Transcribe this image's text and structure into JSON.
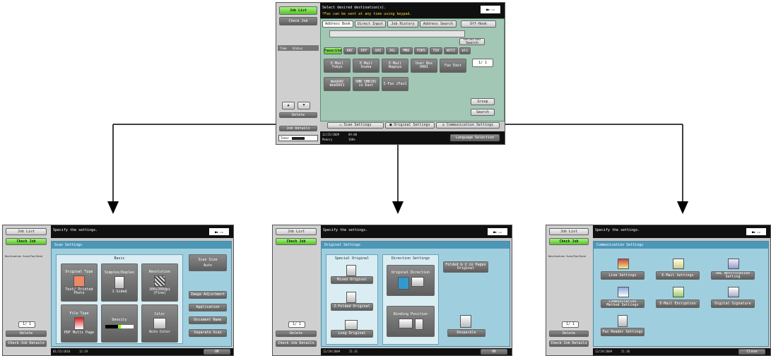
{
  "top_screen": {
    "job_list": "Job List",
    "check_job": "Check Job",
    "status_cols": [
      "Time",
      "Status"
    ],
    "delete": "Delete",
    "job_details": "Job Details",
    "toner": "Toner",
    "message1": "Select desired destination(s).",
    "message2": "*Fax can be sent at any time using keypad.",
    "tabs": [
      "Address Book",
      "Direct Input",
      "Job History",
      "Address Search",
      "Off-Hook"
    ],
    "detail_search": "Detailed Search",
    "index_tabs": [
      "Favorite",
      "ABC",
      "DEF",
      "GHI",
      "JKL",
      "MNO",
      "PQRS",
      "TUV",
      "WXYZ",
      "etc"
    ],
    "destinations": [
      "E-Mail Tokyo",
      "E-Mail Osaka",
      "E-Mail Nagoya",
      "User Box 0001",
      "Fax East",
      "WebDAV WebDAV1",
      "SMB SMB(B) in-East",
      "I-Fax iFax1"
    ],
    "page": "1/ 1",
    "group": "Group",
    "search": "Search",
    "scan_settings": "Scan Settings",
    "original_settings": "Original Settings",
    "comm_settings": "Communication Settings",
    "date": "12/25/2009",
    "time": "09:00",
    "memory_label": "Memory",
    "memory": "100%",
    "language": "Language Selection"
  },
  "scan_screen": {
    "job_list": "Job List",
    "check_job": "Check Job",
    "left_title": "Destination Scan/Fax/Send",
    "page": "1/ 1",
    "delete": "Delete",
    "check_details": "Check Job Details",
    "header": "Specify the settings.",
    "panel": "Scan Settings",
    "basic": "Basic",
    "cells": [
      {
        "title": "Original Type",
        "value": "Text/ Printed Photo"
      },
      {
        "title": "Simplex/Duplex",
        "value": "1-Sided"
      },
      {
        "title": "Resolution",
        "value": "300x300dpi (Fine)"
      },
      {
        "title": "File Type",
        "value": "PDF Multi Page"
      },
      {
        "title": "Density",
        "value": ""
      },
      {
        "title": "Color",
        "value": "Auto Color"
      }
    ],
    "right_buttons": [
      "Image Adjustment",
      "Application",
      "Document Name",
      "Separate Scan"
    ],
    "scan_size": "Scan Size",
    "scan_size_value": "Auto",
    "date": "01/15/2010",
    "time": "12:19",
    "ok": "OK"
  },
  "orig_screen": {
    "job_list": "Job List",
    "check_job": "Check Job",
    "page": "1/ 1",
    "delete": "Delete",
    "check_details": "Check Job Details",
    "header": "Specify the settings.",
    "panel": "Original Settings",
    "special_original": "Special Original",
    "mixed": "Mixed Original",
    "z_folded": "Z-Folded Original",
    "long": "Long Original",
    "direction_settings": "Direction Settings",
    "original_direction": "Original Direction",
    "binding_position": "Binding Position",
    "file_type_note": "Folded & 2 in Pages Original",
    "despeckle": "Despeckle",
    "date": "12/29/2009",
    "time": "21:31",
    "ok": "OK"
  },
  "comm_screen": {
    "job_list": "Job List",
    "check_job": "Check Job",
    "left_title": "Destination Scan/Fax/Send",
    "page": "1/ 1",
    "delete": "Delete",
    "check_details": "Check Job Details",
    "header": "Specify the settings.",
    "panel": "Communication Settings",
    "buttons": [
      "Line Settings",
      "E-Mail Settings",
      "URL Notification Setting",
      "Communication Method Settings",
      "E-Mail Encryption",
      "Digital Signature",
      "Fax Header Settings"
    ],
    "date": "12/29/2009",
    "time": "21:36",
    "close": "Close"
  }
}
